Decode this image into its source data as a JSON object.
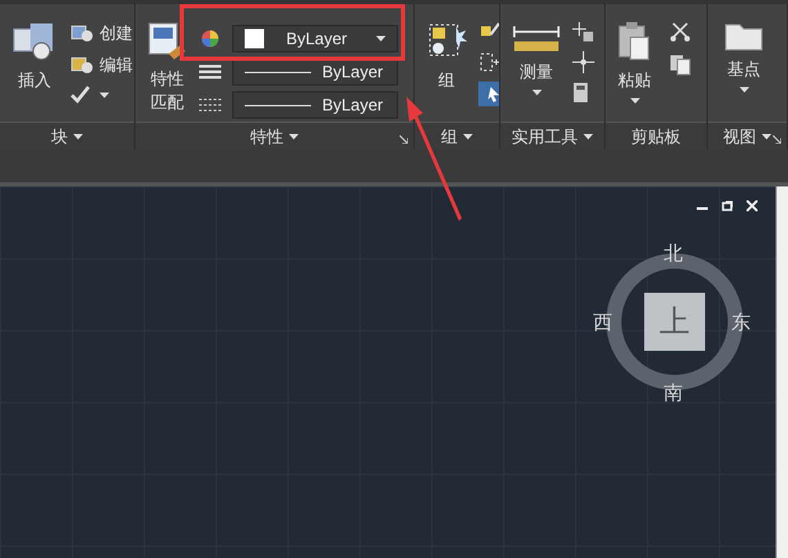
{
  "ribbon": {
    "panels": [
      {
        "kind": "block",
        "title": "块",
        "has_menu": true,
        "launcher": false,
        "large": {
          "label": "插入"
        },
        "small": [
          {
            "label": "创建"
          },
          {
            "label": "编辑"
          }
        ]
      },
      {
        "kind": "properties",
        "title": "特性",
        "has_menu": true,
        "launcher": true,
        "large": {
          "label": "特性匹配"
        },
        "dropdowns": [
          {
            "kind": "color",
            "value": "ByLayer"
          },
          {
            "kind": "lineweight",
            "value": "ByLayer"
          },
          {
            "kind": "linetype",
            "value": "ByLayer"
          }
        ]
      },
      {
        "kind": "group",
        "title": "组",
        "has_menu": true,
        "launcher": false,
        "large": {
          "label": "组"
        }
      },
      {
        "kind": "utilities",
        "title": "实用工具",
        "has_menu": true,
        "launcher": false,
        "large": {
          "label": "测量"
        }
      },
      {
        "kind": "clipboard",
        "title": "剪贴板",
        "has_menu": false,
        "launcher": false,
        "large": {
          "label": "粘贴"
        }
      },
      {
        "kind": "view",
        "title": "视图",
        "has_menu": true,
        "launcher": true,
        "large": {
          "label": "基点"
        }
      }
    ]
  },
  "viewcube": {
    "north": "北",
    "south": "南",
    "east": "东",
    "west": "西",
    "face": "上"
  }
}
